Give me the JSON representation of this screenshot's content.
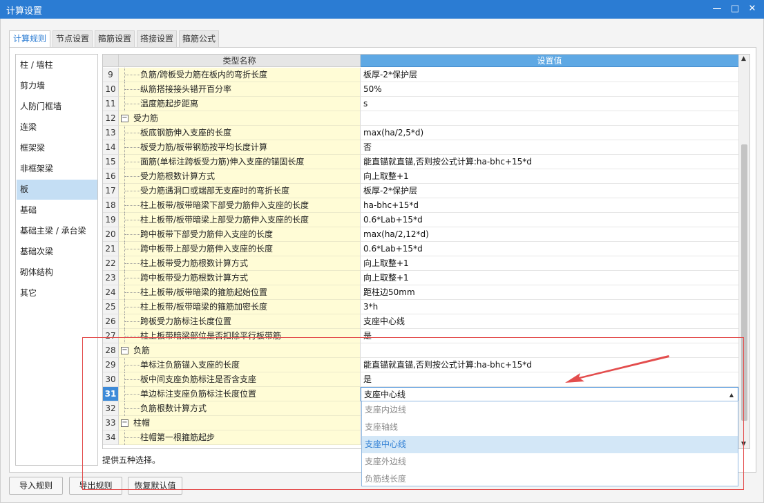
{
  "window": {
    "title": "计算设置",
    "minimize": "—",
    "maximize": "□",
    "close": "✕"
  },
  "tabs": [
    {
      "label": "计算规则",
      "active": true
    },
    {
      "label": "节点设置",
      "active": false
    },
    {
      "label": "箍筋设置",
      "active": false
    },
    {
      "label": "搭接设置",
      "active": false
    },
    {
      "label": "箍筋公式",
      "active": false
    }
  ],
  "sidebar": {
    "items": [
      {
        "label": "柱 / 墙柱"
      },
      {
        "label": "剪力墙"
      },
      {
        "label": "人防门框墙"
      },
      {
        "label": "连梁"
      },
      {
        "label": "框架梁"
      },
      {
        "label": "非框架梁"
      },
      {
        "label": "板",
        "selected": true
      },
      {
        "label": "基础"
      },
      {
        "label": "基础主梁 / 承台梁"
      },
      {
        "label": "基础次梁"
      },
      {
        "label": "砌体结构"
      },
      {
        "label": "其它"
      }
    ]
  },
  "grid": {
    "columns": {
      "name": "类型名称",
      "value": "设置值"
    },
    "rows": [
      {
        "num": "9",
        "name": "负筋/跨板受力筋在板内的弯折长度",
        "value": "板厚-2*保护层"
      },
      {
        "num": "10",
        "name": "纵筋搭接接头错开百分率",
        "value": "50%"
      },
      {
        "num": "11",
        "name": "温度筋起步距离",
        "value": "s"
      },
      {
        "num": "12",
        "name": "受力筋",
        "value": "",
        "group": true,
        "expander": "−"
      },
      {
        "num": "13",
        "name": "板底钢筋伸入支座的长度",
        "value": "max(ha/2,5*d)"
      },
      {
        "num": "14",
        "name": "板受力筋/板带钢筋按平均长度计算",
        "value": "否"
      },
      {
        "num": "15",
        "name": "面筋(单标注跨板受力筋)伸入支座的锚固长度",
        "value": "能直锚就直锚,否则按公式计算:ha-bhc+15*d"
      },
      {
        "num": "16",
        "name": "受力筋根数计算方式",
        "value": "向上取整+1"
      },
      {
        "num": "17",
        "name": "受力筋遇洞口或端部无支座时的弯折长度",
        "value": "板厚-2*保护层"
      },
      {
        "num": "18",
        "name": "柱上板带/板带暗梁下部受力筋伸入支座的长度",
        "value": "ha-bhc+15*d"
      },
      {
        "num": "19",
        "name": "柱上板带/板带暗梁上部受力筋伸入支座的长度",
        "value": "0.6*Lab+15*d"
      },
      {
        "num": "20",
        "name": "跨中板带下部受力筋伸入支座的长度",
        "value": "max(ha/2,12*d)"
      },
      {
        "num": "21",
        "name": "跨中板带上部受力筋伸入支座的长度",
        "value": "0.6*Lab+15*d"
      },
      {
        "num": "22",
        "name": "柱上板带受力筋根数计算方式",
        "value": "向上取整+1"
      },
      {
        "num": "23",
        "name": "跨中板带受力筋根数计算方式",
        "value": "向上取整+1"
      },
      {
        "num": "24",
        "name": "柱上板带/板带暗梁的箍筋起始位置",
        "value": "距柱边50mm"
      },
      {
        "num": "25",
        "name": "柱上板带/板带暗梁的箍筋加密长度",
        "value": "3*h"
      },
      {
        "num": "26",
        "name": "跨板受力筋标注长度位置",
        "value": "支座中心线"
      },
      {
        "num": "27",
        "name": "柱上板带暗梁部位是否扣除平行板带筋",
        "value": "是"
      },
      {
        "num": "28",
        "name": "负筋",
        "value": "",
        "group": true,
        "expander": "−"
      },
      {
        "num": "29",
        "name": "单标注负筋锚入支座的长度",
        "value": "能直锚就直锚,否则按公式计算:ha-bhc+15*d"
      },
      {
        "num": "30",
        "name": "板中间支座负筋标注是否含支座",
        "value": "是"
      },
      {
        "num": "31",
        "name": "单边标注支座负筋标注长度位置",
        "value": "支座中心线",
        "current": true
      },
      {
        "num": "32",
        "name": "负筋根数计算方式",
        "value": ""
      },
      {
        "num": "33",
        "name": "柱帽",
        "value": "",
        "group": true,
        "expander": "−"
      },
      {
        "num": "34",
        "name": "柱帽第一根箍筋起步",
        "value": ""
      }
    ]
  },
  "dropdown": {
    "options": [
      "支座内边线",
      "支座轴线",
      "支座中心线",
      "支座外边线",
      "负筋线长度"
    ],
    "highlighted_index": 2,
    "caret": "▲"
  },
  "status_text": "提供五种选择。",
  "buttons": {
    "import": "导入规则",
    "export": "导出规则",
    "restore": "恢复默认值"
  },
  "colors": {
    "titlebar": "#2b7cd3",
    "value_header": "#5ea8e4",
    "name_cell": "#fffcd6",
    "sidebar_selected": "#c4def4",
    "annotation": "#e34d4d"
  }
}
